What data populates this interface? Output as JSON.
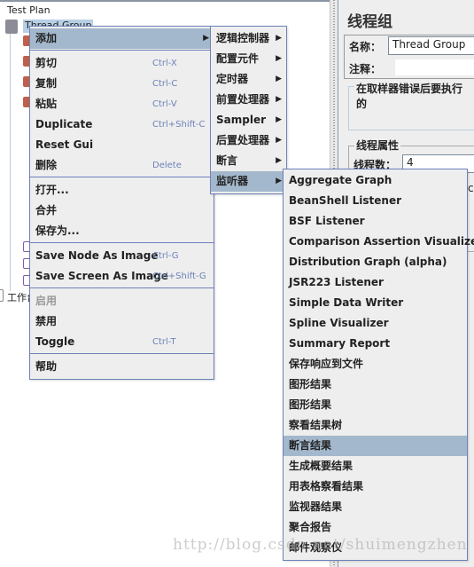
{
  "tree": {
    "root": "Test Plan",
    "selected": "Thread Group",
    "workbench": "工作台"
  },
  "right_panel": {
    "title": "线程组",
    "name_label": "名称：",
    "name_value": "Thread Group",
    "comment_label": "注释：",
    "error_action_label": "在取样器错误后要执行的",
    "thread_props_label": "线程属性",
    "threads_label": "线程数：",
    "threads_value": "4",
    "partial_text": "co"
  },
  "context_menu": {
    "items": [
      {
        "label": "添加",
        "submenu": true,
        "highlighted": true
      },
      {
        "label": "剪切",
        "shortcut": "Ctrl-X"
      },
      {
        "label": "复制",
        "shortcut": "Ctrl-C"
      },
      {
        "label": "粘贴",
        "shortcut": "Ctrl-V"
      },
      {
        "label": "Duplicate",
        "shortcut": "Ctrl+Shift-C"
      },
      {
        "label": "Reset Gui"
      },
      {
        "label": "删除",
        "shortcut": "Delete"
      },
      {
        "label": "打开..."
      },
      {
        "label": "合并"
      },
      {
        "label": "保存为..."
      },
      {
        "label": "Save Node As Image",
        "shortcut": "Ctrl-G"
      },
      {
        "label": "Save Screen As Image",
        "shortcut": "Ctrl+Shift-G"
      },
      {
        "label": "启用",
        "disabled": true
      },
      {
        "label": "禁用"
      },
      {
        "label": "Toggle",
        "shortcut": "Ctrl-T"
      },
      {
        "label": "帮助"
      }
    ]
  },
  "add_submenu": {
    "items": [
      "逻辑控制器",
      "配置元件",
      "定时器",
      "前置处理器",
      "Sampler",
      "后置处理器",
      "断言",
      "监听器"
    ],
    "highlighted": "监听器"
  },
  "listener_submenu": {
    "items": [
      "Aggregate Graph",
      "BeanShell Listener",
      "BSF Listener",
      "Comparison Assertion Visualizer",
      "Distribution Graph (alpha)",
      "JSR223 Listener",
      "Simple Data Writer",
      "Spline Visualizer",
      "Summary Report",
      "保存响应到文件",
      "图形结果",
      "图形结果",
      "察看结果树",
      "断言结果",
      "生成概要结果",
      "用表格察看结果",
      "监视器结果",
      "聚合报告",
      "邮件观察仪"
    ],
    "highlighted": "断言结果"
  },
  "watermark": "http://blog.csdn.net/shuimengzhen",
  "colors": {
    "highlight": "#a3b8cc",
    "menu_border": "#6d82b8",
    "menu_bg": "#eeeeee",
    "shortcut": "#6d82b8"
  }
}
